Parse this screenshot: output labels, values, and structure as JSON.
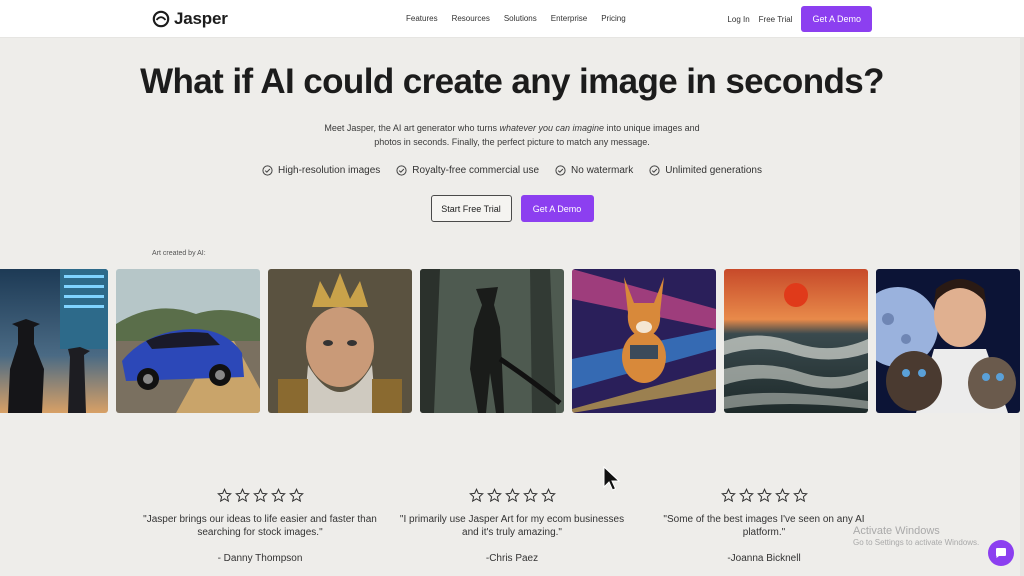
{
  "header": {
    "brand": "Jasper",
    "nav": [
      "Features",
      "Resources",
      "Solutions",
      "Enterprise",
      "Pricing"
    ],
    "login": "Log In",
    "free_trial": "Free Trial",
    "demo": "Get A Demo"
  },
  "hero": {
    "title": "What if AI could create any image in seconds?",
    "sub_before": "Meet Jasper, the AI art generator who turns",
    "sub_em": "whatever you can imagine",
    "sub_after": "into unique images and photos in seconds. Finally, the perfect picture to match any message.",
    "features": [
      "High-resolution images",
      "Royalty-free commercial use",
      "No watermark",
      "Unlimited generations"
    ],
    "cta_trial": "Start Free Trial",
    "cta_demo": "Get A Demo"
  },
  "gallery": {
    "label": "Art created by AI:",
    "images": [
      "cyber-cowboys",
      "blue-sports-car",
      "crowned-king",
      "forest-creature",
      "space-corgi",
      "ocean-sunset",
      "man-with-kittens"
    ]
  },
  "testimonials": [
    {
      "quote": "\"Jasper brings our ideas to life easier and faster than searching for stock images.\"",
      "author": "- Danny Thompson",
      "rating": 0
    },
    {
      "quote": "\"I primarily use Jasper Art for my ecom businesses and it's truly amazing.\"",
      "author": "-Chris Paez",
      "rating": 0
    },
    {
      "quote": "\"Some of the best images I've seen on any AI platform.\"",
      "author": "-Joanna Bicknell",
      "rating": 0
    }
  ],
  "watermark": {
    "title": "Activate Windows",
    "subtitle": "Go to Settings to activate Windows."
  },
  "colors": {
    "accent": "#8c3ff0",
    "background": "#eeedea"
  },
  "icons": [
    "jasper-logo-icon",
    "check-circle-icon",
    "star-outline-icon",
    "chat-icon",
    "mouse-cursor-icon"
  ]
}
